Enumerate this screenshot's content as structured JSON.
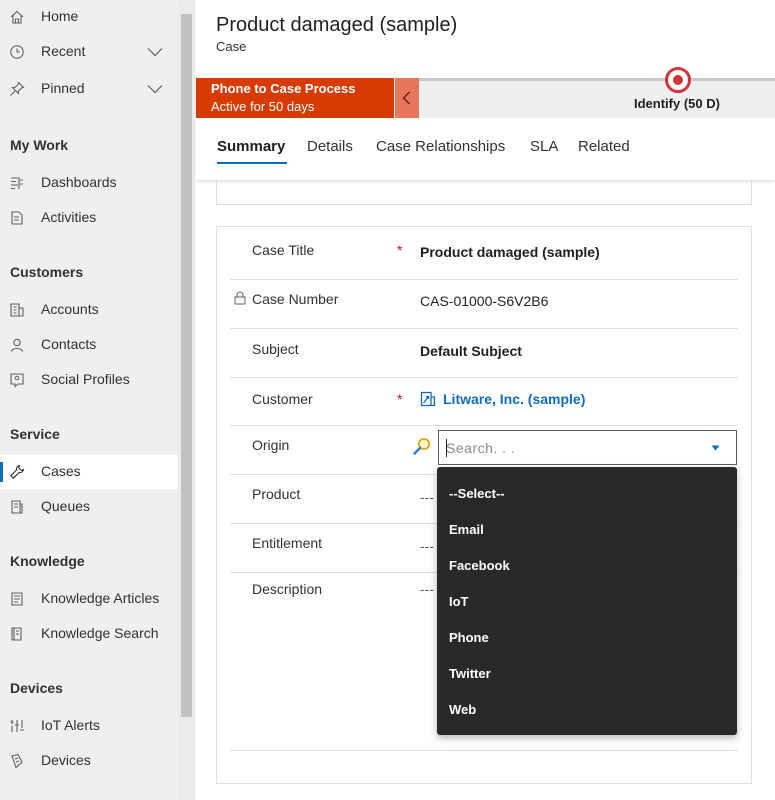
{
  "sidebar": {
    "top_items": [
      {
        "label": "Home",
        "icon": "home-icon"
      },
      {
        "label": "Recent",
        "icon": "clock-icon"
      },
      {
        "label": "Pinned",
        "icon": "pin-icon"
      }
    ],
    "groups": [
      {
        "label": "My Work",
        "items": [
          {
            "label": "Dashboards",
            "icon": "dashboard-icon"
          },
          {
            "label": "Activities",
            "icon": "activities-icon"
          }
        ]
      },
      {
        "label": "Customers",
        "items": [
          {
            "label": "Accounts",
            "icon": "accounts-icon"
          },
          {
            "label": "Contacts",
            "icon": "contact-icon"
          },
          {
            "label": "Social Profiles",
            "icon": "social-profile-icon"
          }
        ]
      },
      {
        "label": "Service",
        "items": [
          {
            "label": "Cases",
            "icon": "wrench-icon"
          },
          {
            "label": "Queues",
            "icon": "queue-icon"
          }
        ]
      },
      {
        "label": "Knowledge",
        "items": [
          {
            "label": "Knowledge Articles",
            "icon": "article-icon"
          },
          {
            "label": "Knowledge Search",
            "icon": "knowledge-search-icon"
          }
        ]
      },
      {
        "label": "Devices",
        "items": [
          {
            "label": "IoT Alerts",
            "icon": "iot-alert-icon"
          },
          {
            "label": "Devices",
            "icon": "device-icon"
          }
        ]
      }
    ]
  },
  "header": {
    "title": "Product damaged (sample)",
    "entity": "Case"
  },
  "process": {
    "name": "Phone to Case Process",
    "status": "Active for 50 days",
    "stage_label": "Identify  (50 D)",
    "accent": "#d83b01"
  },
  "tabs": [
    "Summary",
    "Details",
    "Case Relationships",
    "SLA",
    "Related"
  ],
  "form": {
    "case_title": {
      "label": "Case Title",
      "required": "*",
      "value": "Product damaged (sample)"
    },
    "case_number": {
      "label": "Case Number",
      "value": "CAS-01000-S6V2B6"
    },
    "subject": {
      "label": "Subject",
      "value": "Default Subject"
    },
    "customer": {
      "label": "Customer",
      "required": "*",
      "value": "Litware, Inc. (sample)"
    },
    "origin": {
      "label": "Origin",
      "placeholder": "Search. . ."
    },
    "product": {
      "label": "Product",
      "value": "---"
    },
    "entitlement": {
      "label": "Entitlement",
      "value": "---"
    },
    "description": {
      "label": "Description",
      "value": "---"
    }
  },
  "origin_options": [
    "--Select--",
    "Email",
    "Facebook",
    "IoT",
    "Phone",
    "Twitter",
    "Web"
  ]
}
